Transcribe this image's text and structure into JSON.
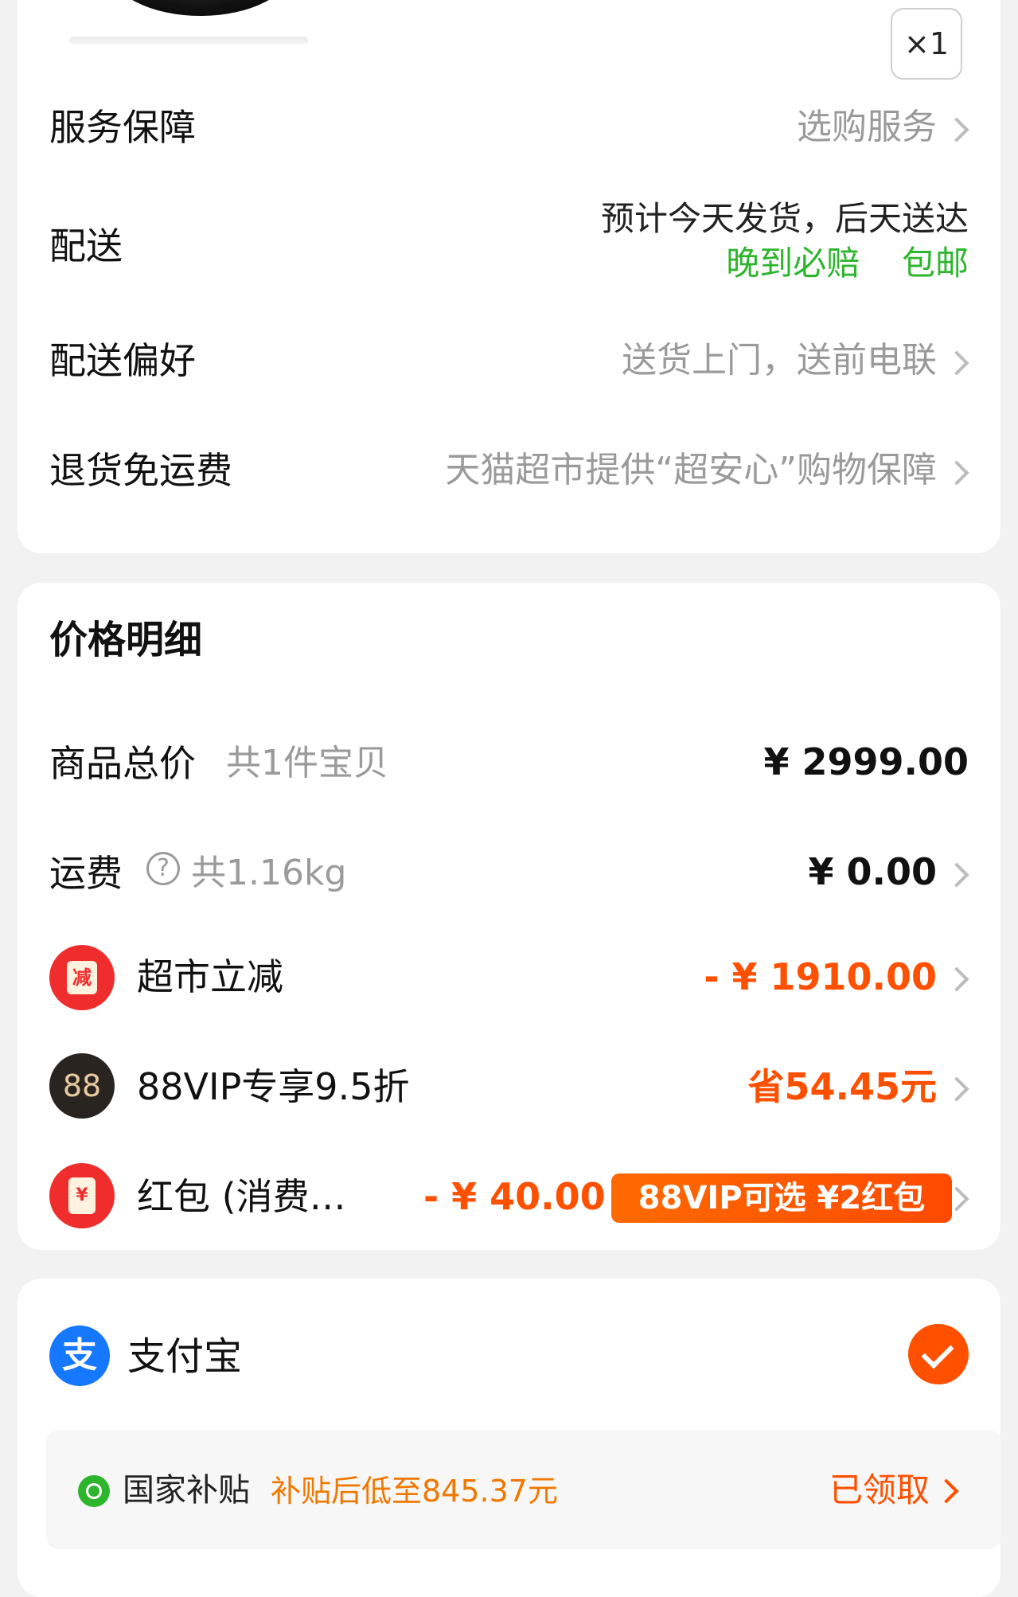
{
  "product": {
    "quantity": "×1"
  },
  "service": {
    "label": "服务保障",
    "value": "选购服务"
  },
  "delivery": {
    "label": "配送",
    "estimate": "预计今天发货，后天送达",
    "guarantee": "晚到必赔",
    "free_shipping": "包邮"
  },
  "delivery_pref": {
    "label": "配送偏好",
    "value": "送货上门，送前电联"
  },
  "returns": {
    "label": "退货免运费",
    "value": "天猫超市提供“超安心”购物保障"
  },
  "price": {
    "title": "价格明细",
    "subtotal": {
      "label": "商品总价",
      "count": "共1件宝贝",
      "value": "¥ 2999.00"
    },
    "shipping": {
      "label": "运费",
      "weight": "共1.16kg",
      "value": "¥ 0.00"
    },
    "discount": {
      "icon_text": "减",
      "label": "超市立减",
      "value": "- ¥ 1910.00"
    },
    "vip": {
      "icon_text": "88",
      "label": "88VIP专享9.5折",
      "value": "省54.45元"
    },
    "red_packet": {
      "icon_text": "¥",
      "label": "红包 (消费…",
      "value": "- ¥ 40.00",
      "badge": "88VIP可选 ¥2红包"
    }
  },
  "payment": {
    "method": "支付宝",
    "subsidy": {
      "label": "国家补贴",
      "detail": "补贴后低至845.37元",
      "status": "已领取"
    }
  },
  "colors": {
    "accent": "#ff5000",
    "green": "#2db52d",
    "alipay": "#1677ff",
    "icon_red": "#f02d2d"
  }
}
